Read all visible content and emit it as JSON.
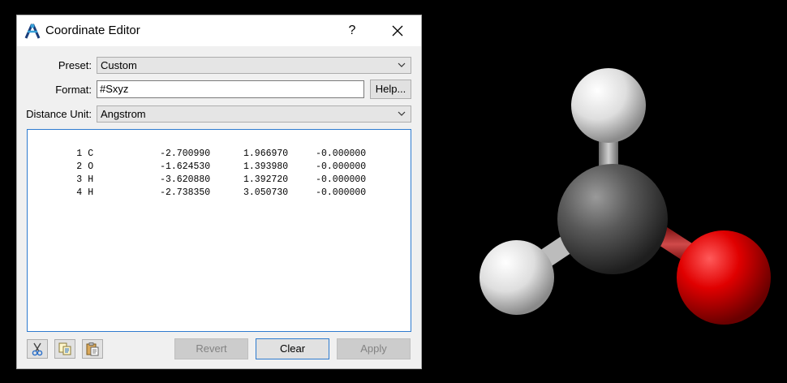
{
  "dialog": {
    "title": "Coordinate Editor",
    "help_glyph": "?",
    "preset_label": "Preset:",
    "preset_value": "Custom",
    "format_label": "Format:",
    "format_value": "#Sxyz",
    "help_button": "Help...",
    "unit_label": "Distance Unit:",
    "unit_value": "Angstrom",
    "coordinates": [
      {
        "index": "1",
        "element": "C",
        "x": "-2.700990",
        "y": "1.966970",
        "z": "-0.000000"
      },
      {
        "index": "2",
        "element": "O",
        "x": "-1.624530",
        "y": "1.393980",
        "z": "-0.000000"
      },
      {
        "index": "3",
        "element": "H",
        "x": "-3.620880",
        "y": "1.392720",
        "z": "-0.000000"
      },
      {
        "index": "4",
        "element": "H",
        "x": "-2.738350",
        "y": "3.050730",
        "z": "-0.000000"
      }
    ],
    "revert_label": "Revert",
    "clear_label": "Clear",
    "apply_label": "Apply"
  },
  "icons": {
    "app": "avogadro-logo-icon",
    "close": "close-icon",
    "cut": "cut-icon",
    "copy": "copy-icon",
    "paste": "paste-icon"
  },
  "colors": {
    "carbon": "#555555",
    "oxygen": "#dd0000",
    "hydrogen": "#e8e8e8",
    "accent": "#2e7bcf"
  }
}
